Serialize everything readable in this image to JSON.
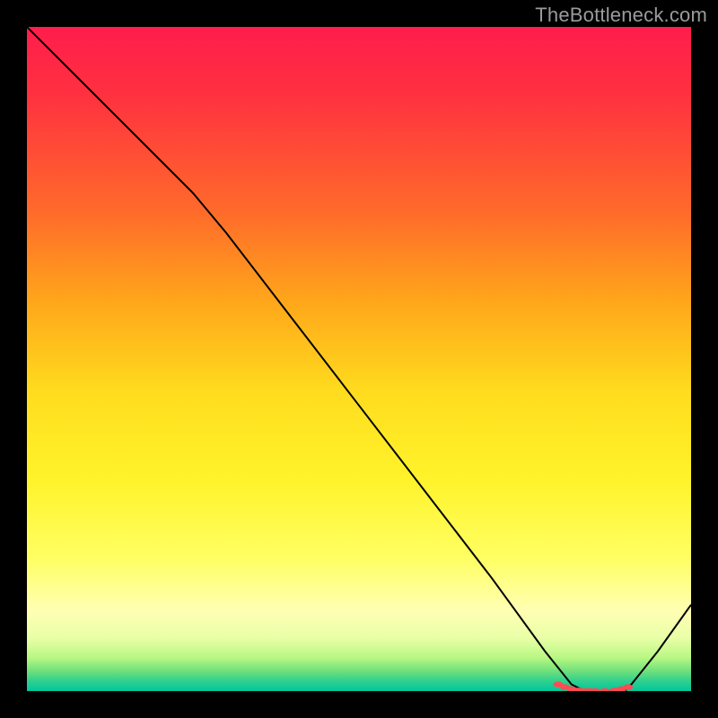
{
  "watermark": "TheBottleneck.com",
  "chart_data": {
    "type": "line",
    "title": "",
    "xlabel": "",
    "ylabel": "",
    "xlim": [
      0,
      100
    ],
    "ylim": [
      0,
      100
    ],
    "grid": false,
    "legend": false,
    "notes": "Chart has no visible axis tick labels, title, or legend. X appears to be a performance/component axis and Y a bottleneck percentage. Values are estimated from pixel position because no labels are rendered.",
    "x": [
      0,
      10,
      20,
      25,
      30,
      40,
      50,
      60,
      70,
      78,
      82,
      84,
      86,
      88,
      90,
      91,
      95,
      100
    ],
    "values": [
      100,
      90,
      80,
      75,
      69,
      56,
      43,
      30,
      17,
      6,
      1,
      0,
      0,
      0,
      0,
      1,
      6,
      13
    ],
    "marker_x": [
      80,
      81,
      82,
      83,
      84,
      84.8,
      85.6,
      87,
      88.5,
      89.5,
      90.5
    ],
    "marker_y": [
      1,
      0.6,
      0.3,
      0.1,
      0,
      0,
      0,
      0,
      0.1,
      0.3,
      0.6
    ],
    "series_color": "#000000",
    "marker_color": "#ff4b52"
  }
}
